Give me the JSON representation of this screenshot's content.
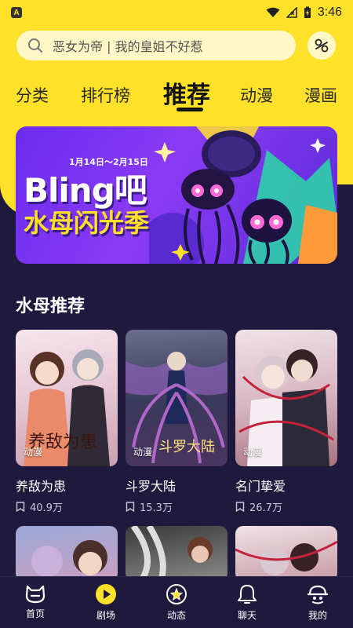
{
  "status_bar": {
    "time": "3:46",
    "app_badge": "A"
  },
  "search": {
    "placeholder": "恶女为帝 | 我的皇姐不好惹"
  },
  "tabs": [
    {
      "label": "分类"
    },
    {
      "label": "排行榜"
    },
    {
      "label": "推荐"
    },
    {
      "label": "动漫"
    },
    {
      "label": "漫画"
    }
  ],
  "banner": {
    "date_range": "1月14日～2月15日",
    "title_en": "Bling吧",
    "title_cn": "水母闪光季"
  },
  "section": {
    "title": "水母推荐"
  },
  "cards": [
    {
      "tag": "动漫",
      "title": "养敌为患",
      "stat": "40.9万",
      "cover_text": "养敌为患"
    },
    {
      "tag": "动漫",
      "title": "斗罗大陆",
      "stat": "15.3万",
      "cover_text": "斗罗大陆"
    },
    {
      "tag": "动漫",
      "title": "名门挚爱",
      "stat": "26.7万",
      "cover_text": ""
    }
  ],
  "nav": [
    {
      "label": "首页",
      "icon": "home-cat-icon"
    },
    {
      "label": "剧场",
      "icon": "play-icon"
    },
    {
      "label": "动态",
      "icon": "star-badge-icon"
    },
    {
      "label": "聊天",
      "icon": "bell-chat-icon"
    },
    {
      "label": "我的",
      "icon": "profile-icon"
    }
  ],
  "colors": {
    "accent_yellow": "#ffe12a",
    "background": "#1f1a3d",
    "banner_purple": "#7a34f2"
  }
}
